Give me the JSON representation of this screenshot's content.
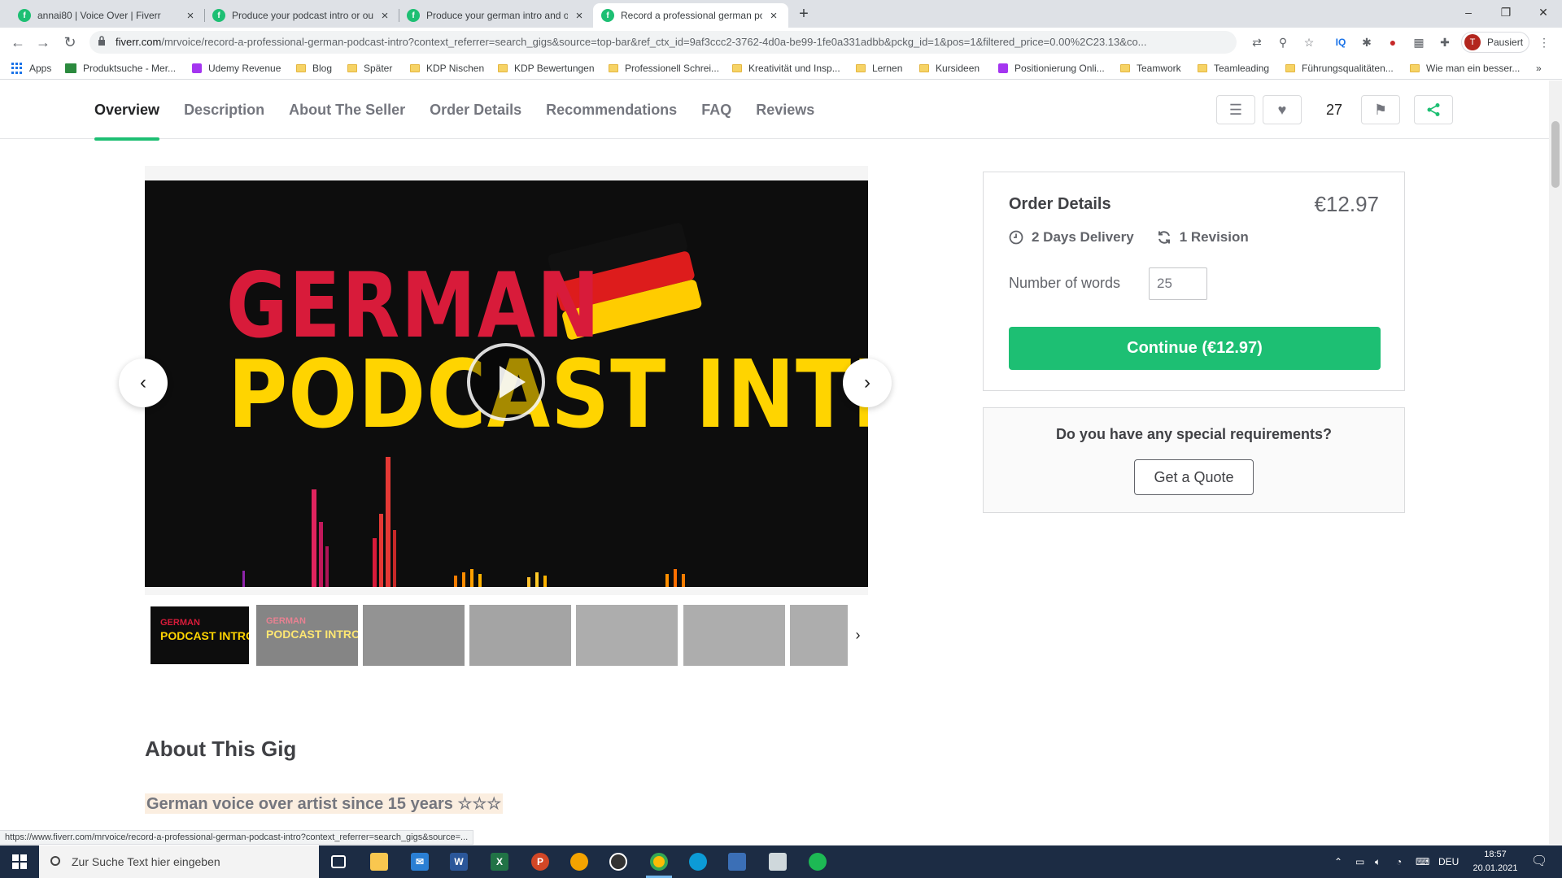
{
  "browser": {
    "tabs": [
      {
        "title": "annai80 | Voice Over | Fiverr"
      },
      {
        "title": "Produce your podcast intro or ou"
      },
      {
        "title": "Produce your german intro and o"
      },
      {
        "title": "Record a professional german po"
      }
    ],
    "new_tab": "+",
    "url_domain": "fiverr.com",
    "url_path": "/mrvoice/record-a-professional-german-podcast-intro?context_referrer=search_gigs&source=top-bar&ref_ctx_id=9af3ccc2-3762-4d0a-be99-1fe0a331adbb&pckg_id=1&pos=1&filtered_price=0.00%2C23.13&co...",
    "profile_initial": "T",
    "profile_label": "Pausiert",
    "bookmarks": [
      "Apps",
      "Produktsuche - Mer...",
      "Udemy Revenue",
      "Blog",
      "Später",
      "KDP Nischen",
      "KDP Bewertungen",
      "Professionell Schrei...",
      "Kreativität und Insp...",
      "Lernen",
      "Kursideen",
      "Positionierung Onli...",
      "Teamwork",
      "Teamleading",
      "Führungsqualitäten...",
      "Wie man ein besser..."
    ],
    "bookmarks_more": "»"
  },
  "gig_nav": {
    "links": [
      "Overview",
      "Description",
      "About The Seller",
      "Order Details",
      "Recommendations",
      "FAQ",
      "Reviews"
    ],
    "active": "Overview",
    "likes_count": "27"
  },
  "gallery": {
    "video_line1": "GERMAN",
    "video_line2": "PODCAST INTRO",
    "thumb_line1": "GERMAN",
    "thumb_line2": "PODCAST INTRO",
    "prev": "‹",
    "next": "›",
    "thumbs_next": "›"
  },
  "about": {
    "title": "About This Gig",
    "subtitle": "German voice over artist since 15 years ☆☆☆"
  },
  "order": {
    "title": "Order Details",
    "price": "€12.97",
    "delivery": "2 Days Delivery",
    "revisions": "1 Revision",
    "words_label": "Number of words",
    "words_value": "25",
    "continue_label": "Continue (€12.97)"
  },
  "quote": {
    "question": "Do you have any special requirements?",
    "button": "Get a Quote"
  },
  "status_url": "https://www.fiverr.com/mrvoice/record-a-professional-german-podcast-intro?context_referrer=search_gigs&source=...",
  "taskbar": {
    "search_placeholder": "Zur Suche Text hier eingeben",
    "language": "DEU",
    "time": "18:57",
    "date": "20.01.2021"
  },
  "colors": {
    "fiverr_green": "#1dbf73",
    "taskbar": "#1c2c44"
  }
}
